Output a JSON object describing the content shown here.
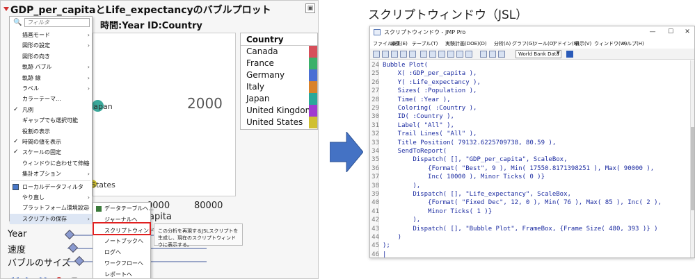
{
  "left": {
    "report_title": "GDP_per_capitaとLife_expectancyのバブルプロット",
    "subtitle": "時間:Year  ID:Country",
    "year_display": "2000",
    "bubble_labels": [
      "Japan",
      "States"
    ],
    "x_ticks": [
      "0000",
      "80000"
    ],
    "x_axis_partial": "apita",
    "legend": {
      "header": "Country",
      "items": [
        {
          "label": "Canada",
          "color": "#d64f5a"
        },
        {
          "label": "France",
          "color": "#3ab06a"
        },
        {
          "label": "Germany",
          "color": "#4a6fd4"
        },
        {
          "label": "Italy",
          "color": "#d9822b"
        },
        {
          "label": "Japan",
          "color": "#2aa89a"
        },
        {
          "label": "United Kingdom",
          "color": "#a03ad0"
        },
        {
          "label": "United States",
          "color": "#d0c030"
        }
      ]
    },
    "sliders": [
      {
        "label": "Year",
        "value": 0.0
      },
      {
        "label": "速度",
        "value": 0.0
      },
      {
        "label": "バブルのサイズ",
        "value": 0.12
      }
    ],
    "menu": {
      "search_placeholder": "フィルタ",
      "items": [
        {
          "label": "描画モード",
          "submenu": true
        },
        {
          "label": "図形の設定",
          "submenu": true
        },
        {
          "label": "図形の向き",
          "submenu": false
        },
        {
          "label": "軌跡 バブル",
          "submenu": true
        },
        {
          "label": "軌跡 線",
          "submenu": true
        },
        {
          "label": "ラベル",
          "submenu": true
        },
        {
          "label": "カラーテーマ...",
          "submenu": false
        },
        {
          "label": "凡例",
          "checked": true
        },
        {
          "label": "ギャップでも選択可能",
          "submenu": false
        },
        {
          "label": "役割の表示",
          "submenu": false
        },
        {
          "label": "時間の値を表示",
          "checked": true
        },
        {
          "label": "スケールの固定",
          "checked": true
        },
        {
          "label": "ウィンドウに合わせて伸縮",
          "submenu": true
        },
        {
          "label": "集計オプション",
          "submenu": true
        },
        {
          "label": "ローカルデータフィルタ",
          "icon": true
        },
        {
          "label": "やり直し",
          "submenu": true
        },
        {
          "label": "プラットフォーム環境設定",
          "submenu": true
        },
        {
          "label": "スクリプトの保存",
          "submenu": true
        }
      ]
    },
    "submenu": {
      "items": [
        "データテーブルへ...",
        "ジャーナルへ",
        "スクリプトウィンドウへ",
        "ノートブックへ",
        "ログへ",
        "ワークフローへ",
        "レポートへ"
      ]
    },
    "tooltip": "この分析を再現するJSLスクリプトを生成し、現在のスクリプトウィンドウに表示する。"
  },
  "right": {
    "heading": "スクリプトウィンドウ（JSL）",
    "window_title": "スクリプトウィンドウ - JMP Pro",
    "menubar": [
      "ファイル(F)",
      "編集(E)",
      "テーブル(T)",
      "実験計画(DOE)(D)",
      "分析(A)",
      "グラフ(G)",
      "ツール(O)",
      "アドイン(N)",
      "表示(V)",
      "ウィンドウ(W)",
      "ヘルプ(H)"
    ],
    "table_select": "World Bank Data",
    "code_lines": [
      {
        "n": "24",
        "text": "Bubble Plot("
      },
      {
        "n": "25",
        "text": "    X( :GDP_per_capita ),"
      },
      {
        "n": "26",
        "text": "    Y( :Life_expectancy ),"
      },
      {
        "n": "27",
        "text": "    Sizes( :Population ),"
      },
      {
        "n": "28",
        "text": "    Time( :Year ),"
      },
      {
        "n": "29",
        "text": "    Coloring( :Country ),"
      },
      {
        "n": "30",
        "text": "    ID( :Country ),"
      },
      {
        "n": "31",
        "text": "    Label( \"All\" ),"
      },
      {
        "n": "32",
        "text": "    Trail Lines( \"All\" ),"
      },
      {
        "n": "33",
        "text": "    Title Position( 79132.6225709738, 80.59 ),"
      },
      {
        "n": "34",
        "text": "    SendToReport("
      },
      {
        "n": "35",
        "text": "        Dispatch( [], \"GDP_per_capita\", ScaleBox,"
      },
      {
        "n": "36",
        "text": "            {Format( \"Best\", 9 ), Min( 17550.8171398251 ), Max( 90000 ),"
      },
      {
        "n": "37",
        "text": "            Inc( 10000 ), Minor Ticks( 0 )}"
      },
      {
        "n": "38",
        "text": "        ),"
      },
      {
        "n": "39",
        "text": "        Dispatch( [], \"Life_expectancy\", ScaleBox,"
      },
      {
        "n": "40",
        "text": "            {Format( \"Fixed Dec\", 12, 0 ), Min( 76 ), Max( 85 ), Inc( 2 ),"
      },
      {
        "n": "41",
        "text": "            Minor Ticks( 1 )}"
      },
      {
        "n": "42",
        "text": "        ),"
      },
      {
        "n": "43",
        "text": "        Dispatch( [], \"Bubble Plot\", FrameBox, {Frame Size( 480, 393 )} )"
      },
      {
        "n": "44",
        "text": "    )"
      },
      {
        "n": "45",
        "text": ");"
      },
      {
        "n": "46",
        "text": "|"
      }
    ]
  },
  "colors": {
    "arrow": "#4472c4",
    "highlight_box": "#e02020",
    "code_text": "#1a2aa0"
  }
}
